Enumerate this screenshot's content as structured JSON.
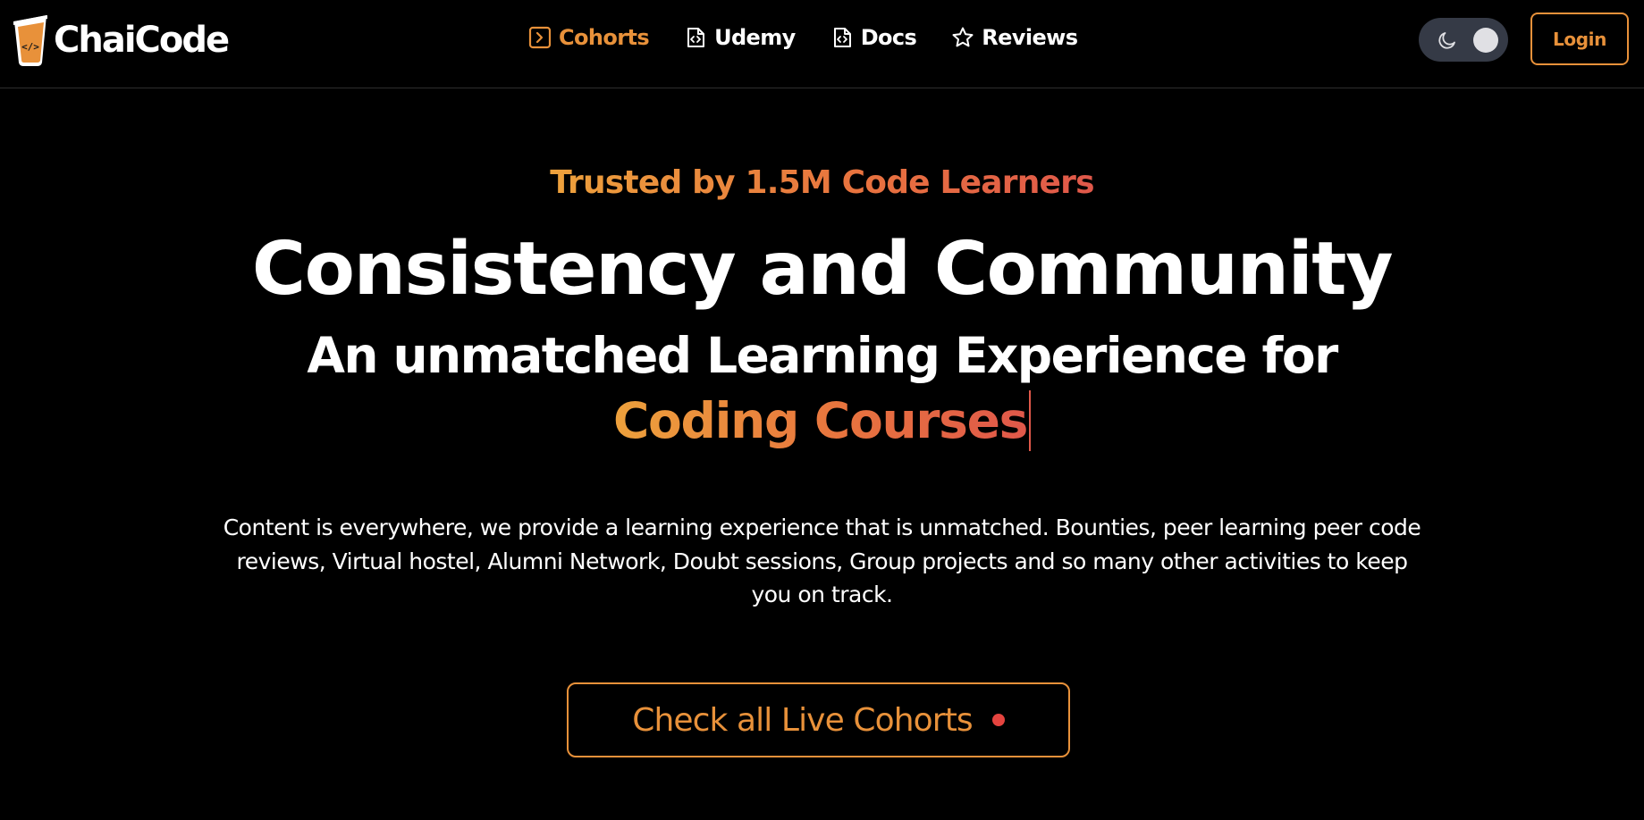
{
  "brand": {
    "name": "ChaiCode",
    "cup_glyph": "</>",
    "accent_color": "#e8913a"
  },
  "nav": {
    "items": [
      {
        "label": "Cohorts",
        "icon": "terminal-square-icon",
        "active": true
      },
      {
        "label": "Udemy",
        "icon": "file-code-icon",
        "active": false
      },
      {
        "label": "Docs",
        "icon": "file-code-icon",
        "active": false
      },
      {
        "label": "Reviews",
        "icon": "star-icon",
        "active": false
      }
    ]
  },
  "header": {
    "theme_toggle_icon": "moon-icon",
    "login_label": "Login"
  },
  "hero": {
    "trusted_label": "Trusted by 1.5M Code Learners",
    "headline": "Consistency and Community",
    "subline": "An unmatched Learning Experience for",
    "typed_text": "Coding Courses",
    "description": "Content is everywhere, we provide a learning experience that is unmatched. Bounties, peer learning peer code reviews, Virtual hostel, Alumni Network, Doubt sessions, Group projects and so many other activities to keep you on track.",
    "cta_label": "Check all Live Cohorts",
    "gradient_colors": [
      "#eda13c",
      "#e8743e",
      "#e0584a"
    ],
    "live_dot_color": "#e5443f"
  }
}
